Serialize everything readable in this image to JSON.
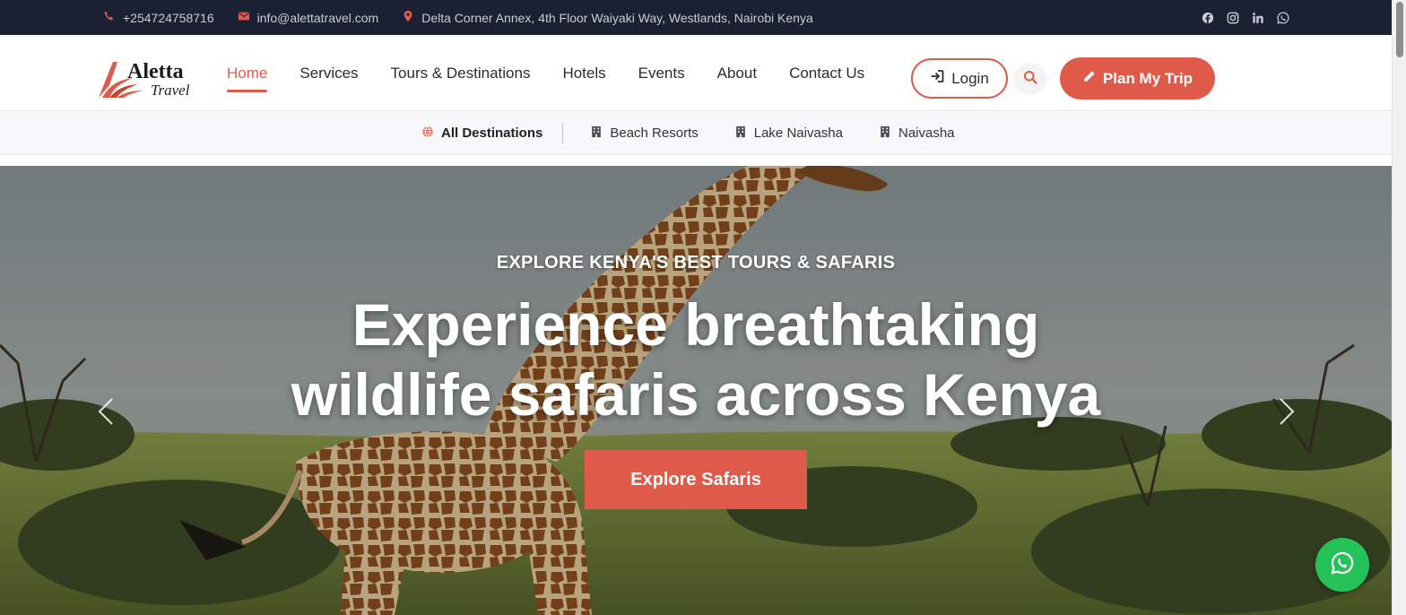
{
  "topbar": {
    "phone": "+254724758716",
    "email": "info@alettatravel.com",
    "address": "Delta Corner Annex, 4th Floor Waiyaki Way, Westlands, Nairobi Kenya",
    "social": [
      "facebook-icon",
      "instagram-icon",
      "linkedin-icon",
      "whatsapp-icon"
    ]
  },
  "nav": {
    "logo_primary": "Aletta",
    "logo_secondary": "Travel",
    "items": [
      {
        "label": "Home",
        "active": true
      },
      {
        "label": "Services"
      },
      {
        "label": "Tours & Destinations"
      },
      {
        "label": "Hotels"
      },
      {
        "label": "Events"
      },
      {
        "label": "About"
      },
      {
        "label": "Contact Us"
      }
    ],
    "login_label": "Login",
    "plan_label": "Plan My Trip"
  },
  "subnav": {
    "all_label": "All Destinations",
    "destinations": [
      "Beach Resorts",
      "Lake Naivasha",
      "Naivasha"
    ]
  },
  "hero": {
    "kicker": "EXPLORE KENYA'S BEST TOURS & SAFARIS",
    "headline": "Experience breathtaking wildlife safaris across Kenya",
    "cta_label": "Explore Safaris"
  },
  "colors": {
    "accent": "#e05a4a",
    "topbar_bg": "#1b2133",
    "whatsapp": "#25c25a"
  }
}
